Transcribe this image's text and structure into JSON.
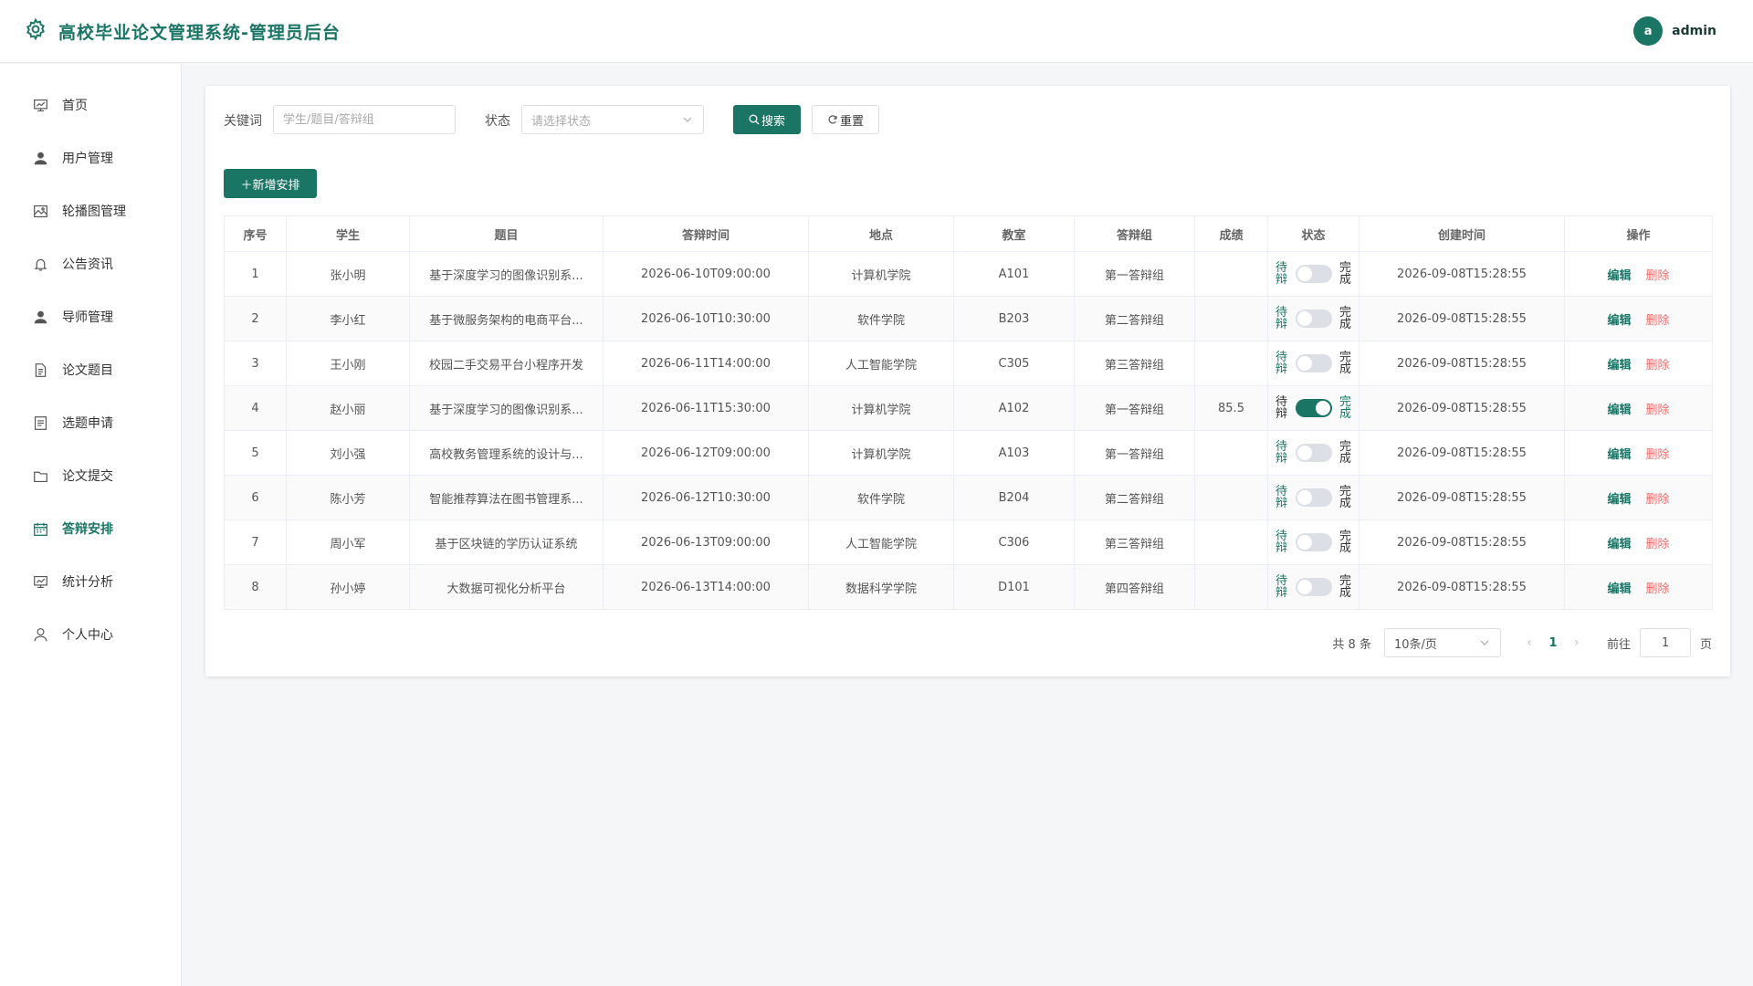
{
  "header": {
    "title": "高校毕业论文管理系统-管理员后台",
    "avatar_letter": "a",
    "username": "admin"
  },
  "sidebar": {
    "items": [
      {
        "label": "首页",
        "icon": "monitor-icon"
      },
      {
        "label": "用户管理",
        "icon": "user-icon"
      },
      {
        "label": "轮播图管理",
        "icon": "image-icon"
      },
      {
        "label": "公告资讯",
        "icon": "bell-icon"
      },
      {
        "label": "导师管理",
        "icon": "user-icon"
      },
      {
        "label": "论文题目",
        "icon": "document-icon"
      },
      {
        "label": "选题申请",
        "icon": "list-icon"
      },
      {
        "label": "论文提交",
        "icon": "folder-icon"
      },
      {
        "label": "答辩安排",
        "icon": "calendar-icon",
        "active": true
      },
      {
        "label": "统计分析",
        "icon": "chart-icon"
      },
      {
        "label": "个人中心",
        "icon": "user-outline-icon"
      }
    ]
  },
  "filters": {
    "keyword_label": "关键词",
    "keyword_placeholder": "学生/题目/答辩组",
    "status_label": "状态",
    "status_placeholder": "请选择状态",
    "search_label": "搜索",
    "reset_label": "重置"
  },
  "add_button_label": "新增安排",
  "table": {
    "headers": [
      "序号",
      "学生",
      "题目",
      "答辩时间",
      "地点",
      "教室",
      "答辩组",
      "成绩",
      "状态",
      "创建时间",
      "操作"
    ],
    "switch_off_text": "待辩",
    "switch_on_text": "完成",
    "edit_label": "编辑",
    "delete_label": "删除",
    "rows": [
      {
        "no": "1",
        "student": "张小明",
        "topic": "基于深度学习的图像识别系...",
        "time": "2026-06-10T09:00:00",
        "place": "计算机学院",
        "room": "A101",
        "group": "第一答辩组",
        "score": "",
        "done": false,
        "created": "2026-09-08T15:28:55"
      },
      {
        "no": "2",
        "student": "李小红",
        "topic": "基于微服务架构的电商平台...",
        "time": "2026-06-10T10:30:00",
        "place": "软件学院",
        "room": "B203",
        "group": "第二答辩组",
        "score": "",
        "done": false,
        "created": "2026-09-08T15:28:55"
      },
      {
        "no": "3",
        "student": "王小刚",
        "topic": "校园二手交易平台小程序开发",
        "time": "2026-06-11T14:00:00",
        "place": "人工智能学院",
        "room": "C305",
        "group": "第三答辩组",
        "score": "",
        "done": false,
        "created": "2026-09-08T15:28:55"
      },
      {
        "no": "4",
        "student": "赵小丽",
        "topic": "基于深度学习的图像识别系...",
        "time": "2026-06-11T15:30:00",
        "place": "计算机学院",
        "room": "A102",
        "group": "第一答辩组",
        "score": "85.5",
        "done": true,
        "created": "2026-09-08T15:28:55"
      },
      {
        "no": "5",
        "student": "刘小强",
        "topic": "高校教务管理系统的设计与...",
        "time": "2026-06-12T09:00:00",
        "place": "计算机学院",
        "room": "A103",
        "group": "第一答辩组",
        "score": "",
        "done": false,
        "created": "2026-09-08T15:28:55"
      },
      {
        "no": "6",
        "student": "陈小芳",
        "topic": "智能推荐算法在图书管理系...",
        "time": "2026-06-12T10:30:00",
        "place": "软件学院",
        "room": "B204",
        "group": "第二答辩组",
        "score": "",
        "done": false,
        "created": "2026-09-08T15:28:55"
      },
      {
        "no": "7",
        "student": "周小军",
        "topic": "基于区块链的学历认证系统",
        "time": "2026-06-13T09:00:00",
        "place": "人工智能学院",
        "room": "C306",
        "group": "第三答辩组",
        "score": "",
        "done": false,
        "created": "2026-09-08T15:28:55"
      },
      {
        "no": "8",
        "student": "孙小婷",
        "topic": "大数据可视化分析平台",
        "time": "2026-06-13T14:00:00",
        "place": "数据科学学院",
        "room": "D101",
        "group": "第四答辩组",
        "score": "",
        "done": false,
        "created": "2026-09-08T15:28:55"
      }
    ]
  },
  "pagination": {
    "total_text": "共 8 条",
    "page_size": "10条/页",
    "current_page": "1",
    "goto_label": "前往",
    "goto_value": "1",
    "page_suffix": "页"
  },
  "colors": {
    "primary": "#1a7565",
    "danger": "#f56c6c"
  }
}
